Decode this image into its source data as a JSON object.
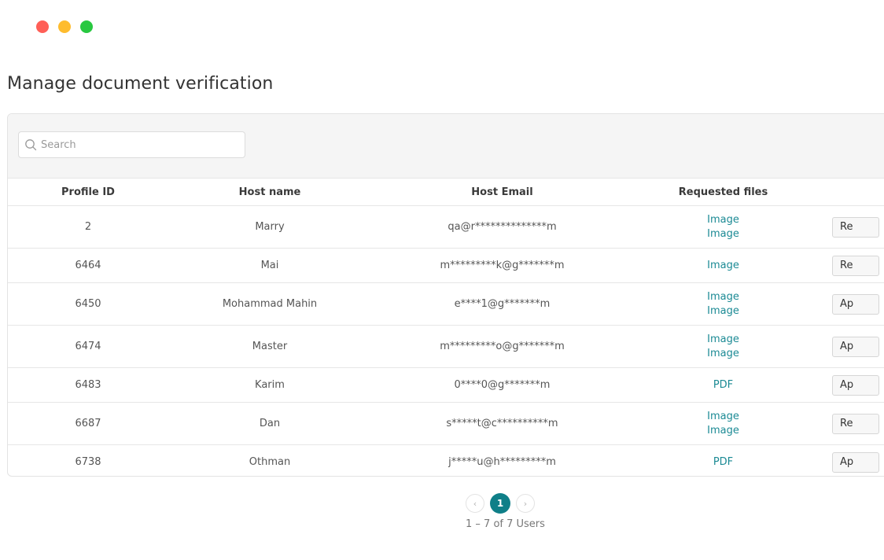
{
  "window": {
    "controls": [
      {
        "name": "close",
        "color": "#ff5f57"
      },
      {
        "name": "minimize",
        "color": "#febc2e"
      },
      {
        "name": "maximize",
        "color": "#28c840"
      }
    ]
  },
  "page": {
    "title": "Manage document verification"
  },
  "search": {
    "placeholder": "Search",
    "value": ""
  },
  "table": {
    "columns": [
      "Profile ID",
      "Host name",
      "Host Email",
      "Requested files",
      ""
    ],
    "rows": [
      {
        "profile_id": "2",
        "host_name": "Marry",
        "host_email": "qa@r**************m",
        "files": [
          "Image",
          "Image"
        ],
        "action": "Re"
      },
      {
        "profile_id": "6464",
        "host_name": "Mai",
        "host_email": "m*********k@g*******m",
        "files": [
          "Image"
        ],
        "action": "Re"
      },
      {
        "profile_id": "6450",
        "host_name": "Mohammad Mahin",
        "host_email": "e****1@g*******m",
        "files": [
          "Image",
          "Image"
        ],
        "action": "Ap"
      },
      {
        "profile_id": "6474",
        "host_name": "Master",
        "host_email": "m*********o@g*******m",
        "files": [
          "Image",
          "Image"
        ],
        "action": "Ap"
      },
      {
        "profile_id": "6483",
        "host_name": "Karim",
        "host_email": "0****0@g*******m",
        "files": [
          "PDF"
        ],
        "action": "Ap"
      },
      {
        "profile_id": "6687",
        "host_name": "Dan",
        "host_email": "s*****t@c**********m",
        "files": [
          "Image",
          "Image"
        ],
        "action": "Re"
      },
      {
        "profile_id": "6738",
        "host_name": "Othman",
        "host_email": "j*****u@h*********m",
        "files": [
          "PDF"
        ],
        "action": "Ap"
      }
    ]
  },
  "pagination": {
    "prev_icon": "chevron-left-icon",
    "next_icon": "chevron-right-icon",
    "prev_glyph": "‹",
    "next_glyph": "›",
    "current_page": "1",
    "summary": "1 – 7 of 7 Users"
  },
  "colors": {
    "accent": "#0f7f88",
    "link": "#1b8a94"
  }
}
